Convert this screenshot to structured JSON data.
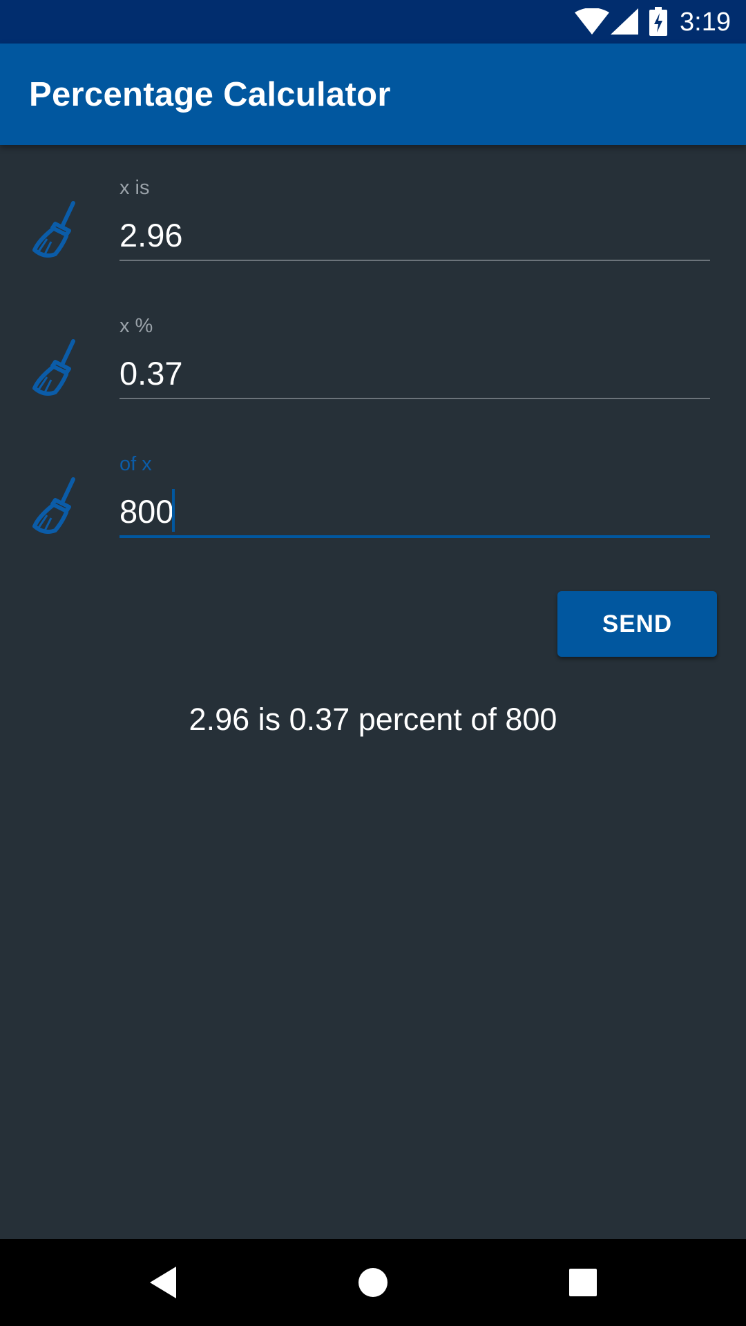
{
  "status_bar": {
    "time": "3:19",
    "icons": [
      "wifi-icon",
      "cell-signal-icon",
      "battery-charging-icon"
    ]
  },
  "app_bar": {
    "title": "Percentage Calculator"
  },
  "fields": [
    {
      "label": "x is",
      "value": "2.96",
      "icon": "broom-icon",
      "focused": false
    },
    {
      "label": "x %",
      "value": "0.37",
      "icon": "broom-icon",
      "focused": false
    },
    {
      "label": "of x",
      "value": "800",
      "icon": "broom-icon",
      "focused": true
    }
  ],
  "send_button": {
    "label": "SEND"
  },
  "result": {
    "text": "2.96 is 0.37 percent of 800"
  },
  "nav_bar": {
    "buttons": [
      "back-icon",
      "home-icon",
      "recents-icon"
    ]
  },
  "colors": {
    "status_bar": "#012d6e",
    "primary": "#01579f",
    "background": "#263038",
    "label_inactive": "#9aa2a9",
    "label_active": "#0b5ca8",
    "text": "#ffffff"
  }
}
